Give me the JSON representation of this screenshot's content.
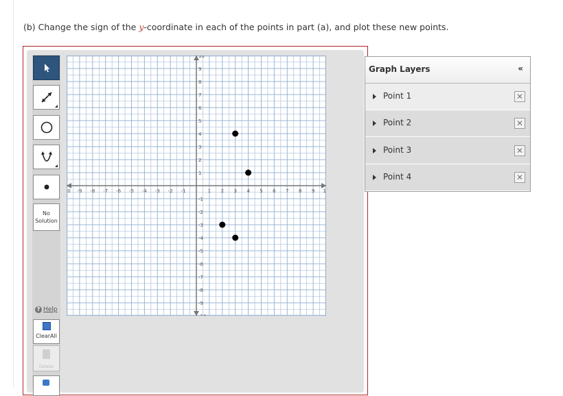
{
  "question": {
    "prefix": "(b) Change the sign of the ",
    "variable": "y",
    "suffix": "-coordinate in each of the points in part (a), and plot these new points."
  },
  "toolbar": {
    "no_solution_line1": "No",
    "no_solution_line2": "Solution",
    "help_label": "Help",
    "clear_all_label": "ClearAll",
    "delete_label": "Delete",
    "colors": {
      "selected": "#2d557e",
      "action_blue": "#3d78c7"
    }
  },
  "graph": {
    "xlim": [
      -10,
      10
    ],
    "ylim": [
      -10,
      10
    ],
    "x_ticks": [
      "-10",
      "-9",
      "-8",
      "-7",
      "-6",
      "-5",
      "-4",
      "-3",
      "-2",
      "-1",
      "1",
      "2",
      "3",
      "4",
      "5",
      "6",
      "7",
      "8",
      "9",
      "10"
    ],
    "y_ticks": [
      "10",
      "9",
      "8",
      "7",
      "6",
      "5",
      "4",
      "3",
      "2",
      "1",
      "-1",
      "-2",
      "-3",
      "-4",
      "-5",
      "-6",
      "-7",
      "-8",
      "-9",
      "-10"
    ],
    "points": [
      {
        "x": 3,
        "y": 4
      },
      {
        "x": 4,
        "y": 1
      },
      {
        "x": 2,
        "y": -3
      },
      {
        "x": 3,
        "y": -4
      }
    ],
    "colors": {
      "grid": "#9ab6d4",
      "axis": "#777777",
      "point": "#000000"
    }
  },
  "layers": {
    "title": "Graph Layers",
    "collapse_label": "«",
    "items": [
      {
        "label": "Point 1"
      },
      {
        "label": "Point 2"
      },
      {
        "label": "Point 3"
      },
      {
        "label": "Point 4"
      }
    ],
    "delete_glyph": "✕"
  }
}
